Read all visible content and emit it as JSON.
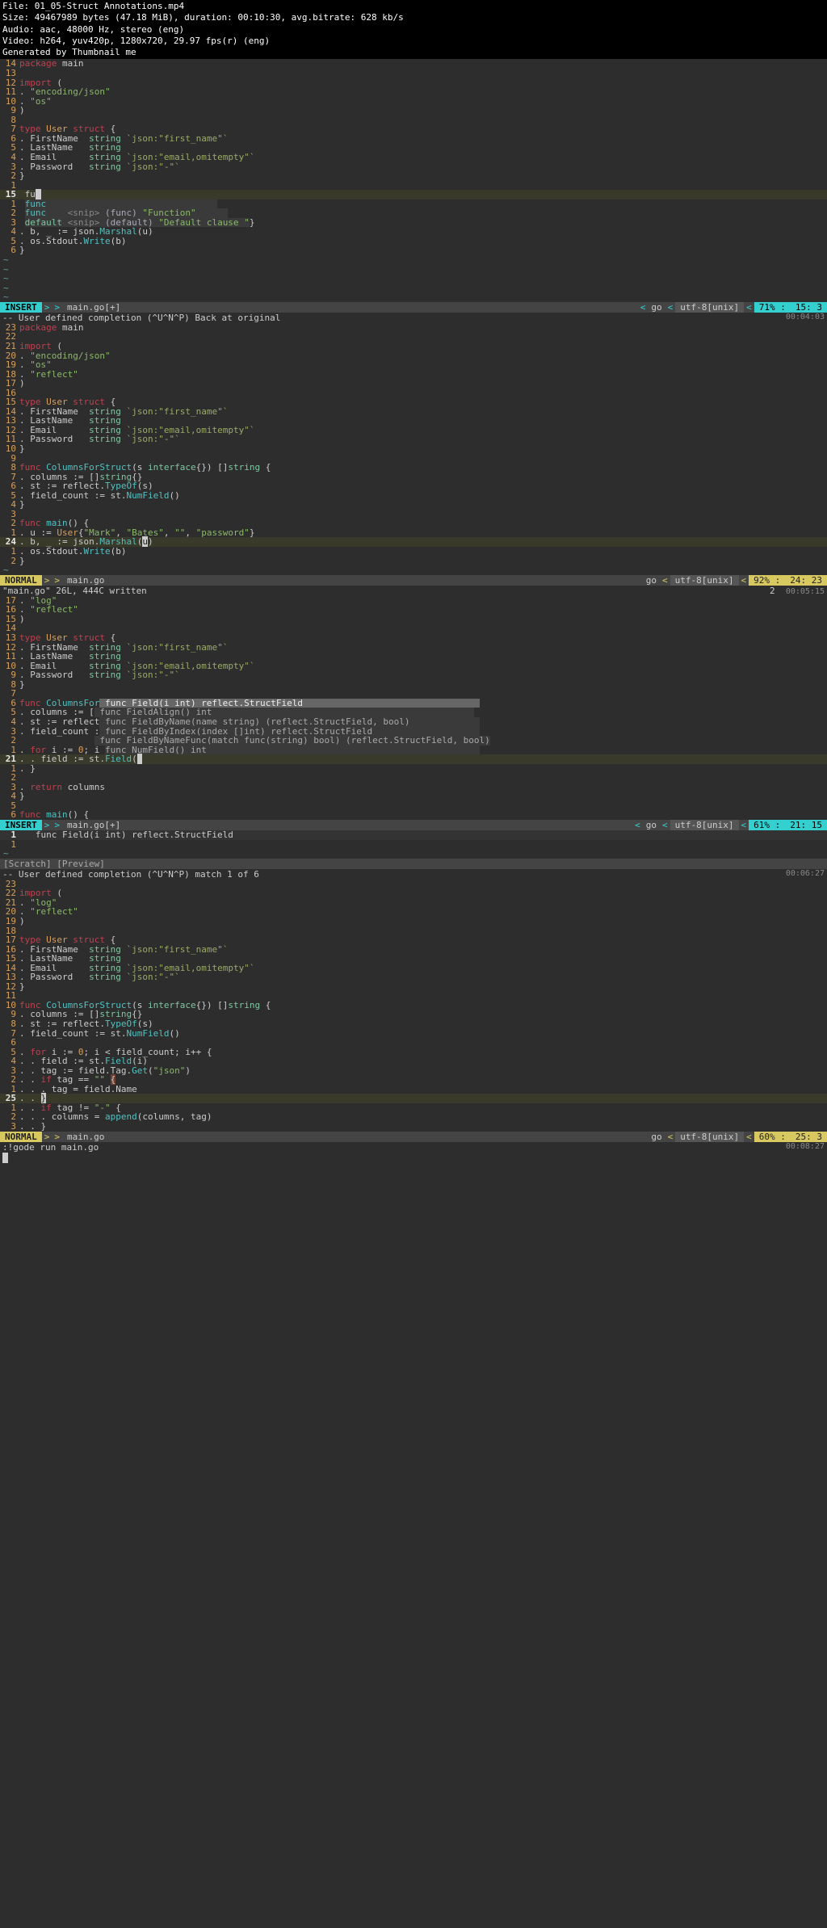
{
  "header": {
    "file": "File: 01_05-Struct Annotations.mp4",
    "size": "Size: 49467989 bytes (47.18 MiB), duration: 00:10:30, avg.bitrate: 628 kb/s",
    "audio": "Audio: aac, 48000 Hz, stereo (eng)",
    "video": "Video: h264, yuv420p, 1280x720, 29.97 fps(r) (eng)",
    "gen": "Generated by Thumbnail me"
  },
  "frame1": {
    "status_mode": "INSERT",
    "status_file": "main.go[+]",
    "status_ft": "go",
    "status_enc": "utf-8[unix]",
    "status_pct": "71% :",
    "status_pos": "15:  3",
    "msg": "-- User defined completion (^U^N^P) Back at original",
    "ts": "00:04:03"
  },
  "frame2": {
    "status_mode": "NORMAL",
    "status_file": "main.go",
    "status_ft": "go",
    "status_enc": "utf-8[unix]",
    "status_pct": "92% :",
    "status_pos": "24: 23",
    "msg": "\"main.go\" 26L, 444C written",
    "msg_right": "2",
    "ts": "00:05:15"
  },
  "frame3": {
    "status_mode": "INSERT",
    "status_file": "main.go[+]",
    "status_ft": "go",
    "status_enc": "utf-8[unix]",
    "status_pct": "61% :",
    "status_pos": "21: 15",
    "preview_func": "func Field(i int) reflect.StructField",
    "preview_bar": "[Scratch] [Preview]",
    "msg": "-- User defined completion (^U^N^P) match 1 of 6",
    "ts": "00:06:27",
    "popup": [
      "func Field(i int) reflect.StructField",
      "func FieldAlign() int",
      "func FieldByName(name string) (reflect.StructField, bool)",
      "func FieldByIndex(index []int) reflect.StructField",
      "func FieldByNameFunc(match func(string) bool) (reflect.StructField, bool)",
      "func NumField() int"
    ]
  },
  "frame4": {
    "status_mode": "NORMAL",
    "status_file": "main.go",
    "status_ft": "go",
    "status_enc": "utf-8[unix]",
    "status_pct": "60% :",
    "status_pos": "25:  3",
    "cmd": ":!gode run main.go",
    "ts": "00:08:27"
  }
}
